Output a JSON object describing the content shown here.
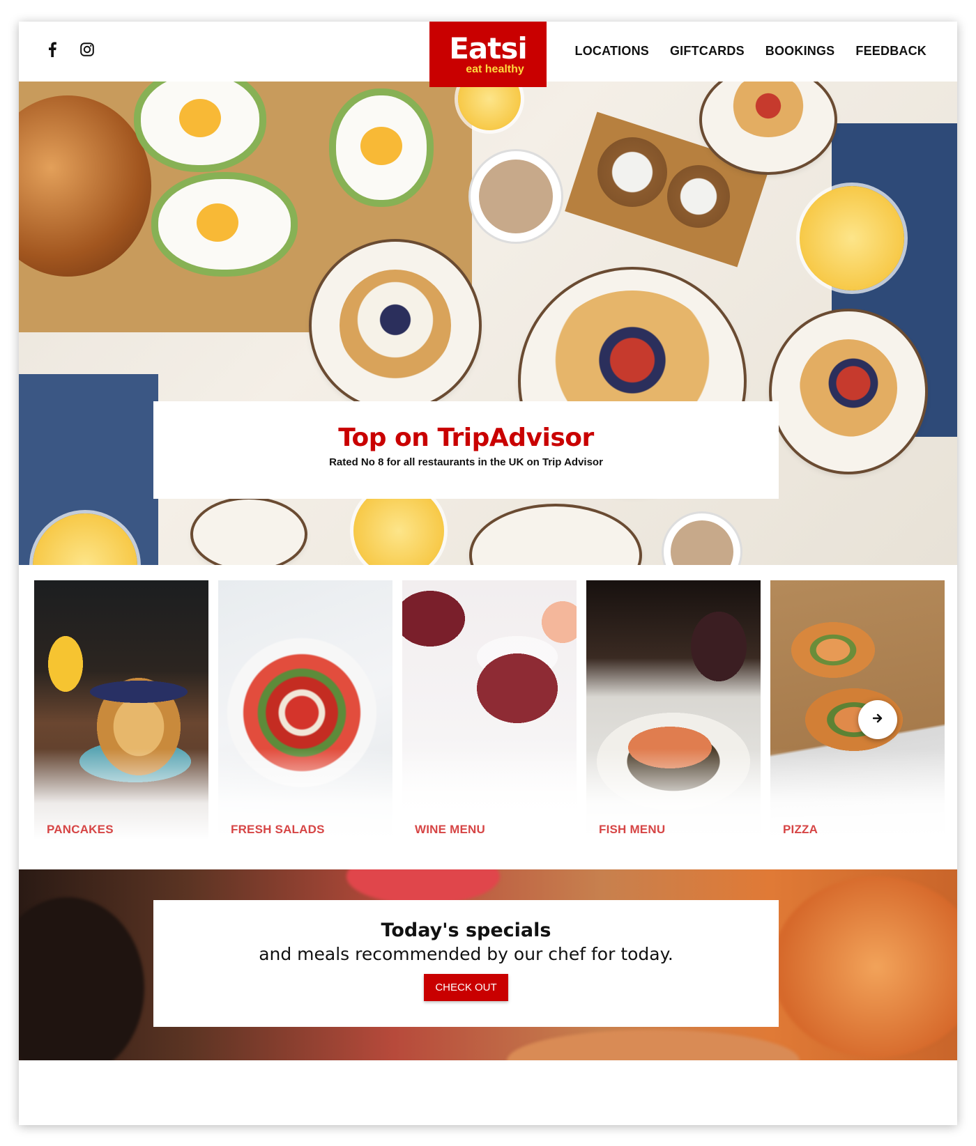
{
  "header": {
    "social": [
      {
        "name": "facebook-icon"
      },
      {
        "name": "instagram-icon"
      }
    ],
    "logo": {
      "name": "Eatsi",
      "tagline": "eat healthy"
    },
    "nav": [
      "LOCATIONS",
      "GIFTCARDS",
      "BOOKINGS",
      "FEEDBACK"
    ]
  },
  "hero": {
    "title": "Top on TripAdvisor",
    "subtitle": "Rated No 8 for all restaurants in the UK on Trip Advisor"
  },
  "carousel": {
    "items": [
      {
        "label": "PANCAKES"
      },
      {
        "label": "FRESH SALADS"
      },
      {
        "label": "WINE MENU"
      },
      {
        "label": "FISH MENU"
      },
      {
        "label": "PIZZA"
      }
    ],
    "next_icon": "arrow-right-icon"
  },
  "specials": {
    "title": "Today's specials",
    "subtitle": "and meals recommended by our chef for today.",
    "button": "CHECK OUT"
  },
  "colors": {
    "brand_red": "#c90000",
    "tagline_yellow": "#ffd93d",
    "card_label_red": "#d64545"
  }
}
